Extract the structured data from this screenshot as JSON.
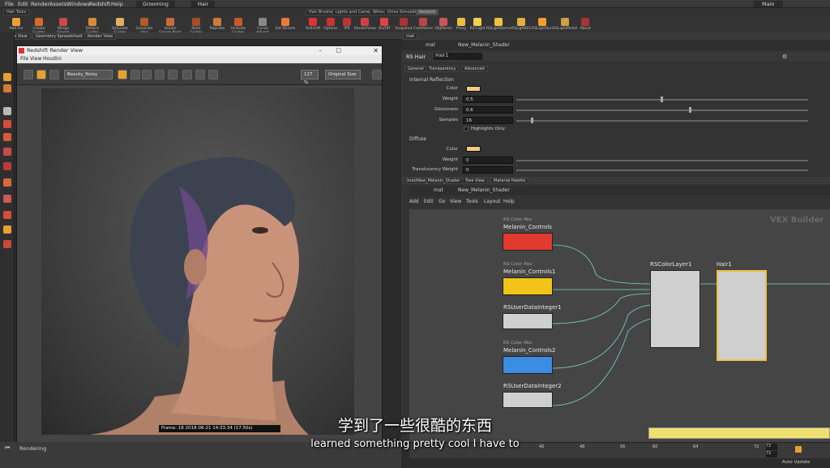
{
  "menubar": {
    "items": [
      "File",
      "Edit",
      "Render",
      "Assets",
      "Windows",
      "Redshift",
      "Help"
    ],
    "desktop": "Grooming",
    "context": "Hair",
    "desktop_right": "Main"
  },
  "shelf": {
    "left_tabs": [
      "Hair Tools"
    ],
    "left_tools": [
      "Add Fur",
      "Create Guides",
      "Merge Groom Objects",
      "Deform Guides",
      "Simulate Guides",
      "Generate Hair",
      "Isolate Groom Parts",
      "Paint Guides",
      "Reprobe",
      "Animate Guides",
      "Curve Advect",
      "Set Directs"
    ],
    "right_tabs": [
      "Hair Brushes",
      "Lights and Cameras",
      "Wires",
      "Drive Simulation",
      "Redshift"
    ],
    "right_tools": [
      "Redshift",
      "Options",
      "IPR",
      "RenderView",
      "On/Off",
      "Snapshot",
      "CamParms",
      "ObjParms",
      "Proxy",
      "RS-Light",
      "RSLightDome",
      "RSLightIES",
      "RSLightSun",
      "RSLightPortal",
      "About"
    ]
  },
  "left_panes": [
    "Scene View",
    "Geometry Spreadsheet",
    "Render View"
  ],
  "render_view": {
    "title": "Redshift Render View",
    "menu": [
      "File",
      "View",
      "Houdini"
    ],
    "aov": "Beauty_Noisy",
    "zoom": "127 %",
    "fit": "Original Size",
    "frame_info": "Frame: 18  2018-06-21  14:33:34  (17.50s)"
  },
  "status": "Rendering",
  "param_panel": {
    "path": "mat",
    "node": "New_Melanin_Shader",
    "type": "RS Hair",
    "name": "Hair1",
    "tabs": [
      "General",
      "Transparency",
      "Advanced"
    ],
    "section1": "Internal Reflection",
    "section2": "Diffuse",
    "rows": [
      {
        "label": "Color",
        "value": ""
      },
      {
        "label": "Weight",
        "value": "0.5"
      },
      {
        "label": "Glossiness",
        "value": "0.6"
      },
      {
        "label": "Samples",
        "value": "16"
      },
      {
        "label": "Highlights Only",
        "value": ""
      },
      {
        "label": "Color",
        "value": ""
      },
      {
        "label": "Weight",
        "value": "0"
      },
      {
        "label": "Translucency Weight",
        "value": "0"
      }
    ]
  },
  "network": {
    "tabs": [
      "/mat/New_Melanin_Shader",
      "Tree View",
      "Material Palette"
    ],
    "path": "mat",
    "node": "New_Melanin_Shader",
    "menu": [
      "Add",
      "Edit",
      "Go",
      "View",
      "Tools",
      "Layout",
      "Help"
    ],
    "watermark": "VEX Builder",
    "nodes": [
      {
        "type": "RS Color Abs",
        "name": "Melanin_Controls",
        "color": "#e23a2e"
      },
      {
        "type": "RS Color Abs",
        "name": "Melanin_Controls1",
        "color": "#f2c419"
      },
      {
        "type": "",
        "name": "RSUserDataInteger1",
        "color": "#cfcfcf"
      },
      {
        "type": "RS Color Abs",
        "name": "Melanin_Controls2",
        "color": "#3a8de0"
      },
      {
        "type": "",
        "name": "RSUserDataInteger2",
        "color": "#cfcfcf"
      },
      {
        "type": "",
        "name": "RSColorLayer1",
        "color": "#cfcfcf"
      },
      {
        "type": "",
        "name": "Hair1",
        "color": "#f0c040"
      }
    ]
  },
  "timeline": {
    "ticks": [
      "40",
      "48",
      "56",
      "60",
      "64",
      "72"
    ],
    "end": "72",
    "end2": "72",
    "auto_update": "Auto Update"
  },
  "subtitles": {
    "cn": "学到了一些很酷的东西",
    "en": "learned something pretty cool I have to"
  }
}
